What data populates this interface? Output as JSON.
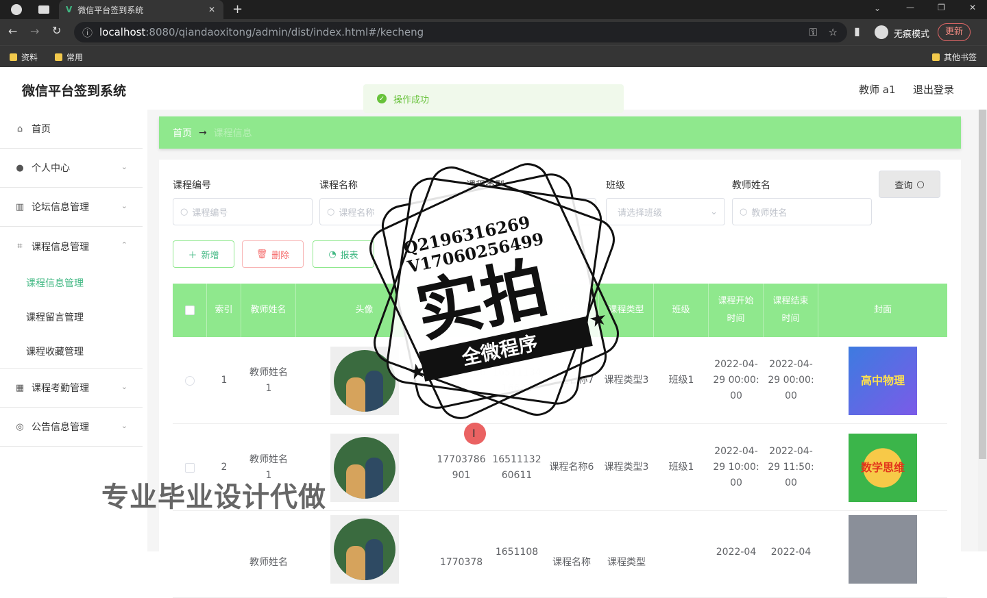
{
  "browser": {
    "tab_title": "微信平台签到系统",
    "url_host": "localhost",
    "url_rest": ":8080/qiandaoxitong/admin/dist/index.html#/kecheng",
    "profile_label": "无痕模式",
    "update_label": "更新",
    "bookmarks": [
      "资料",
      "常用"
    ],
    "other_bookmarks": "其他书签"
  },
  "header": {
    "app_title": "微信平台签到系统",
    "user": "教师 a1",
    "logout": "退出登录"
  },
  "toast": {
    "message": "操作成功"
  },
  "sidebar": {
    "items": [
      {
        "label": "首页"
      },
      {
        "label": "个人中心"
      },
      {
        "label": "论坛信息管理"
      },
      {
        "label": "课程信息管理"
      }
    ],
    "submenu": [
      "课程信息管理",
      "课程留言管理",
      "课程收藏管理"
    ],
    "items_after": [
      {
        "label": "课程考勤管理"
      },
      {
        "label": "公告信息管理"
      }
    ]
  },
  "breadcrumb": {
    "home": "首页",
    "arrow": "→",
    "current": "课程信息"
  },
  "filters": {
    "course_no": {
      "label": "课程编号",
      "placeholder": "课程编号"
    },
    "course_name": {
      "label": "课程名称",
      "placeholder": "课程名称"
    },
    "course_type": {
      "label": "课程类型",
      "placeholder": "课程类型"
    },
    "class": {
      "label": "班级",
      "placeholder": "请选择班级"
    },
    "teacher": {
      "label": "教师姓名",
      "placeholder": "教师姓名"
    },
    "query_button": "查询"
  },
  "actions": {
    "add": "新增",
    "delete": "删除",
    "report": "报表"
  },
  "table": {
    "headers": [
      "索引",
      "教师姓名",
      "头像",
      "课程编号",
      "课程名称",
      "课程类型",
      "班级",
      "课程开始时间",
      "课程结束时间",
      "封面"
    ],
    "rows": [
      {
        "index": "1",
        "teacher": "教师姓名1",
        "col4": "17703786901",
        "col5": "1651113416633",
        "course_name": "课程名称7",
        "course_type": "课程类型3",
        "class": "班级1",
        "start": "2022-04-29 00:00:00",
        "end": "2022-04-29 00:00:00",
        "cover": "高中物理"
      },
      {
        "index": "2",
        "teacher": "教师姓名1",
        "col4": "17703786901",
        "col5": "1651113260611",
        "course_name": "课程名称6",
        "course_type": "课程类型3",
        "class": "班级1",
        "start": "2022-04-29 10:00:00",
        "end": "2022-04-29 11:50:00",
        "cover": "数学思维"
      },
      {
        "index": "3",
        "teacher": "教师姓名",
        "col4": "1770378",
        "col5": "1651108",
        "course_name": "课程名称",
        "course_type": "课程类型",
        "class": "",
        "start": "2022-04",
        "end": "2022-04",
        "cover": ""
      }
    ]
  },
  "overlay": {
    "stamp_line1": "Q2196316269",
    "stamp_line2": "V17060256499",
    "stamp_big": "实拍",
    "stamp_ribbon": "全微程序",
    "watermark": "专业毕业设计代做"
  },
  "colors": {
    "accent": "#8fe88d",
    "primary_text": "#333333"
  }
}
